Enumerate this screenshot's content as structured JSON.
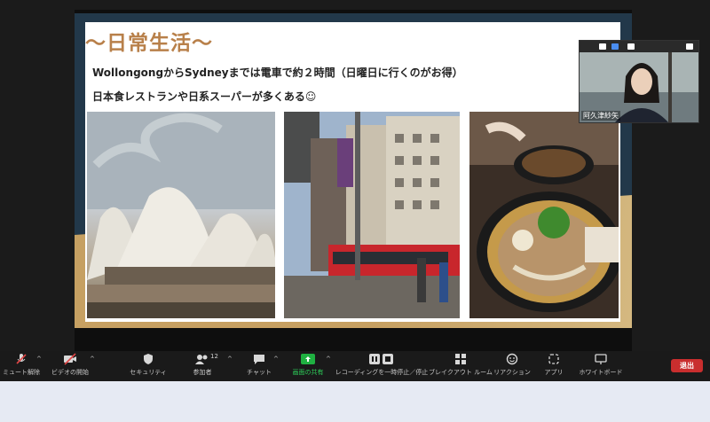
{
  "slide": {
    "title": "〜日常生活〜",
    "line1": "WollongongからSydneyまでは電車で約２時間（日曜日に行くのがお得）",
    "line2": "日本食レストランや日系スーパーが多くある☺"
  },
  "participant": {
    "name": "阿久津紗矢"
  },
  "toolbar": {
    "mute": "ミュート解除",
    "video": "ビデオの開始",
    "security": "セキュリティ",
    "participants": "参加者",
    "participants_count": "12",
    "chat": "チャット",
    "share": "画面の共有",
    "record": "レコーディングを一時停止／停止",
    "breakout": "ブレイクアウト ルーム",
    "reactions": "リアクション",
    "apps": "アプリ",
    "whiteboard": "ホワイトボード",
    "end": "退出"
  },
  "colors": {
    "share_green": "#1fb141",
    "end_red": "#c92e2e",
    "title_brown": "#b8804a",
    "accent_gold": "#c6a062"
  }
}
